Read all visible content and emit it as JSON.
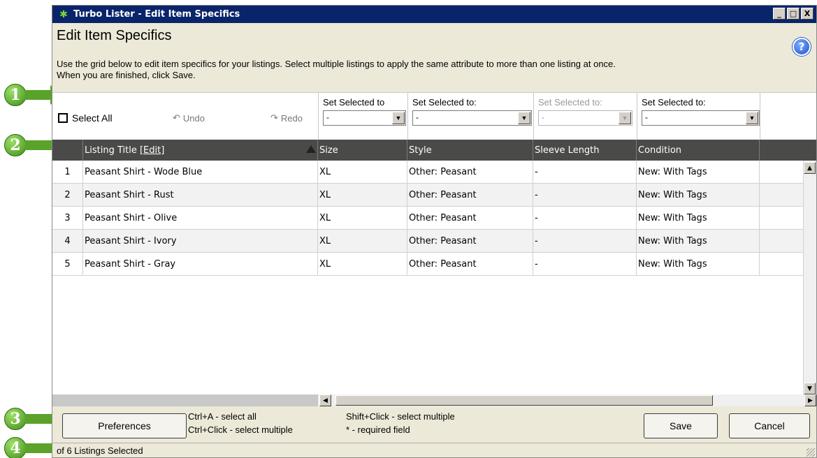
{
  "window": {
    "title": "Turbo Lister - Edit Item Specifics",
    "controls": [
      "_",
      "□",
      "X"
    ]
  },
  "heading": "Edit Item Specifics",
  "help_icon": "?",
  "intro": {
    "line1": "Use the grid below to edit item specifics for your listings. Select multiple listings to apply the same attribute to more than one listing at once.",
    "line2": "When you are finished, click Save."
  },
  "toolbar": {
    "select_all": "Select All",
    "undo": "Undo",
    "redo": "Redo",
    "set_selected": [
      {
        "label": "Set Selected to",
        "value": "-",
        "disabled": false
      },
      {
        "label": "Set Selected to:",
        "value": "-",
        "disabled": false
      },
      {
        "label": "Set Selected to:",
        "value": "-",
        "disabled": true
      },
      {
        "label": "Set Selected to:",
        "value": "-",
        "disabled": false
      }
    ]
  },
  "grid": {
    "columns": [
      "",
      "Listing Title",
      "Size",
      "Style",
      "Sleeve Length",
      "Condition"
    ],
    "edit_link": "[Edit]",
    "rows": [
      {
        "num": "1",
        "title": "Peasant Shirt - Wode Blue",
        "size": "XL",
        "style": "Other: Peasant",
        "sleeve": "-",
        "condition": "New: With Tags"
      },
      {
        "num": "2",
        "title": "Peasant Shirt - Rust",
        "size": "XL",
        "style": "Other: Peasant",
        "sleeve": "-",
        "condition": "New: With Tags"
      },
      {
        "num": "3",
        "title": "Peasant Shirt - Olive",
        "size": "XL",
        "style": "Other: Peasant",
        "sleeve": "-",
        "condition": "New: With Tags"
      },
      {
        "num": "4",
        "title": "Peasant Shirt - Ivory",
        "size": "XL",
        "style": "Other: Peasant",
        "sleeve": "-",
        "condition": "New: With Tags"
      },
      {
        "num": "5",
        "title": "Peasant Shirt - Gray",
        "size": "XL",
        "style": "Other: Peasant",
        "sleeve": "-",
        "condition": "New: With Tags"
      }
    ]
  },
  "footer": {
    "preferences": "Preferences",
    "hint1a": "Ctrl+A - select all",
    "hint1b": "Ctrl+Click - select multiple",
    "hint2a": "Shift+Click - select multiple",
    "hint2b": "* - required field",
    "save": "Save",
    "cancel": "Cancel"
  },
  "status": "of 6 Listings Selected",
  "callouts": [
    "1",
    "2",
    "3",
    "4"
  ],
  "colors": {
    "titlebar": "#0a246a",
    "window_bg": "#ece9d8",
    "grid_header": "#4a4a48",
    "callout": "#5aa22a"
  }
}
